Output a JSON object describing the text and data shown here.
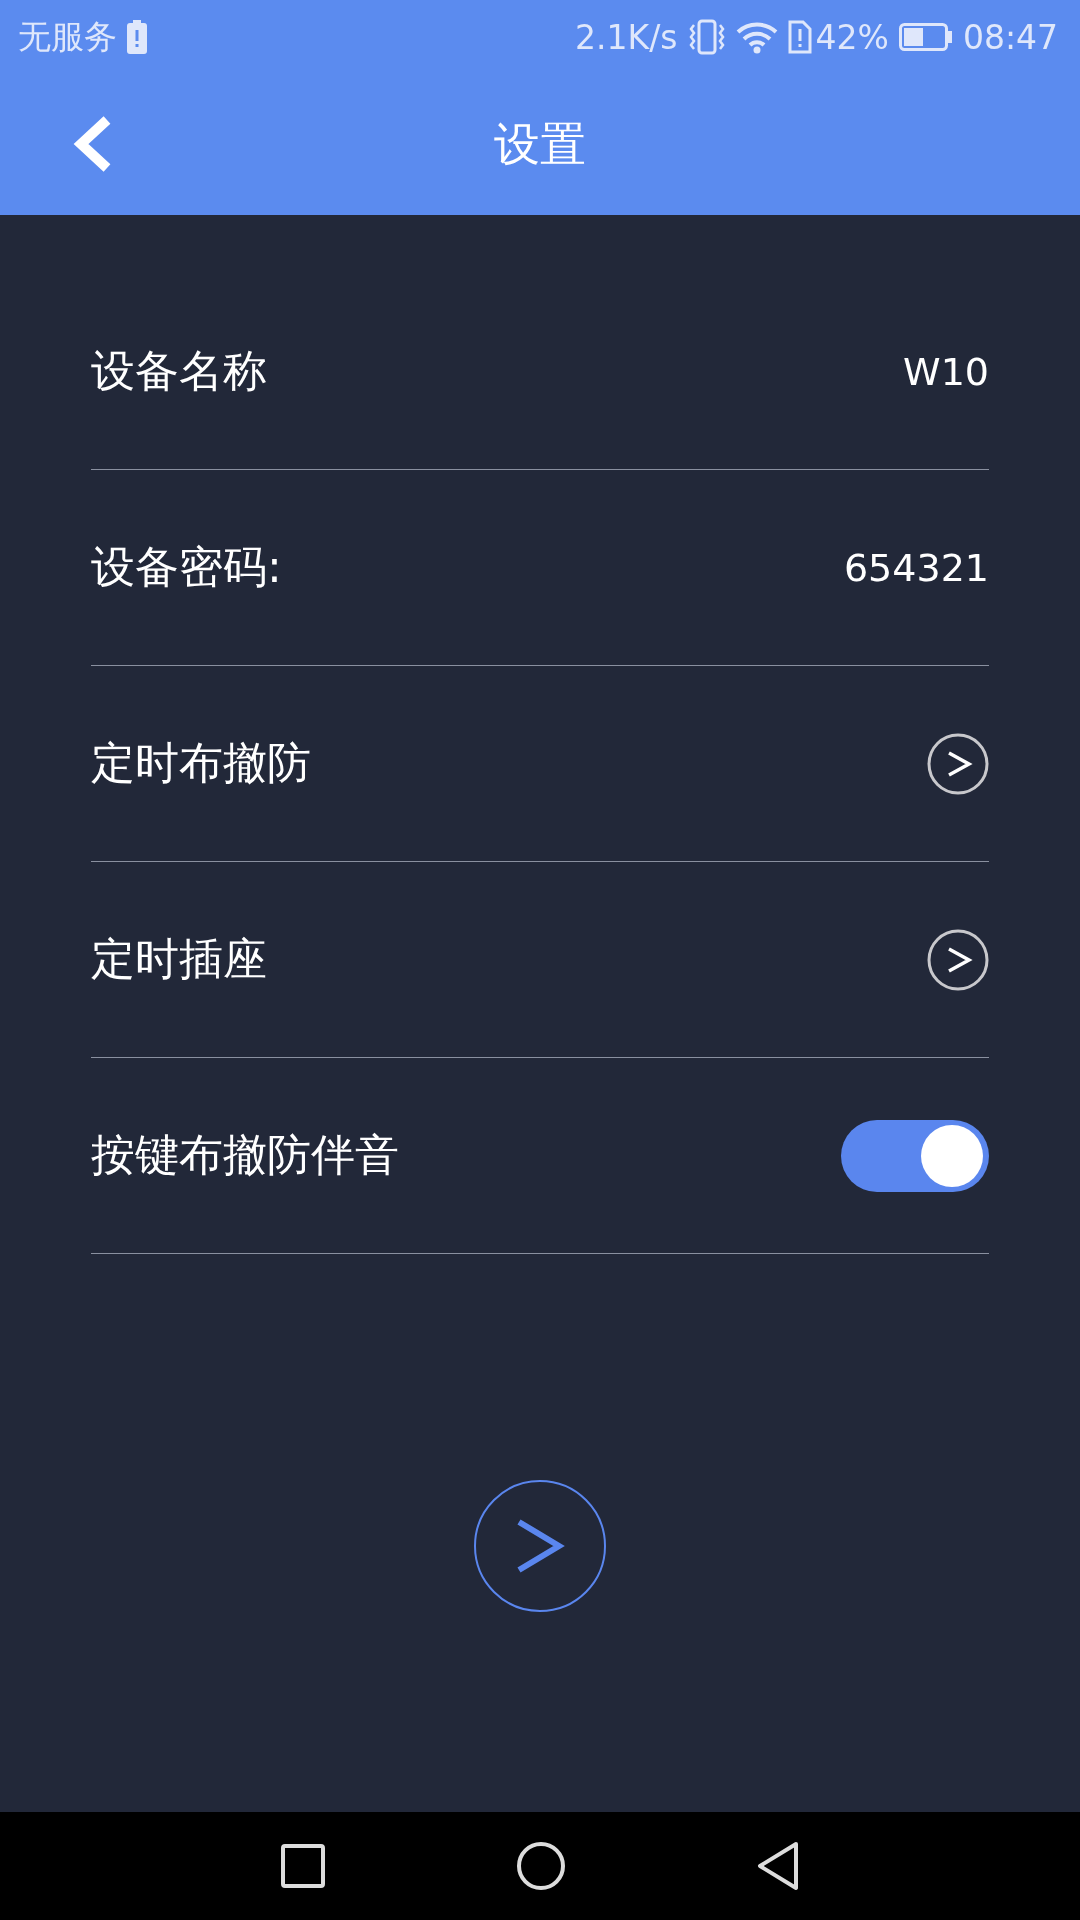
{
  "status_bar": {
    "carrier": "无服务",
    "speed": "2.1K/s",
    "battery": "42%",
    "time": "08:47"
  },
  "header": {
    "title": "设置"
  },
  "settings": [
    {
      "kind": "value",
      "label": "设备名称",
      "value": "W10"
    },
    {
      "kind": "value",
      "label": "设备密码:",
      "value": "654321"
    },
    {
      "kind": "link",
      "label": "定时布撤防"
    },
    {
      "kind": "link",
      "label": "定时插座"
    },
    {
      "kind": "toggle",
      "label": "按键布撤防伴音",
      "on": true
    }
  ]
}
